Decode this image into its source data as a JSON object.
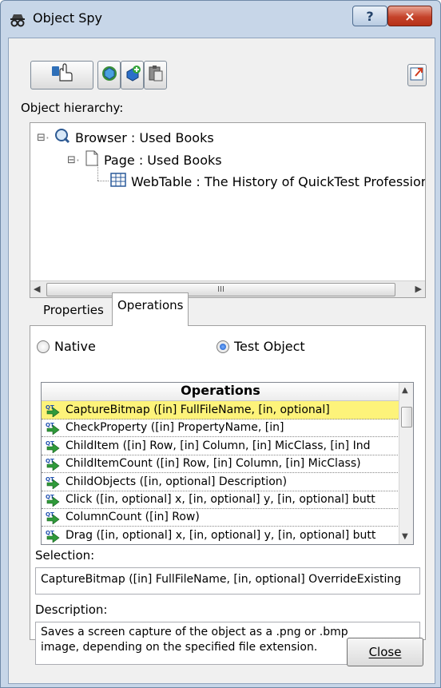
{
  "window": {
    "title": "Object Spy"
  },
  "titlebar": {
    "help_label": "?",
    "close_label": "×"
  },
  "toolbar": {
    "buttons": [
      {
        "icon": "pointing-hand-icon"
      },
      {
        "icon": "highlight-object-icon"
      },
      {
        "icon": "add-object-icon"
      },
      {
        "icon": "copy-clipboard-icon"
      },
      {
        "icon": "keep-on-top-icon"
      }
    ]
  },
  "hierarchy": {
    "label": "Object hierarchy:",
    "nodes": [
      {
        "text": "Browser : Used Books",
        "icon": "browser-icon",
        "expander": "⊟"
      },
      {
        "text": "Page : Used Books",
        "icon": "page-icon",
        "expander": "⊟"
      },
      {
        "text": "WebTable : The History of QuickTest Professior",
        "icon": "table-icon"
      }
    ],
    "scroll_thumb_label": "III"
  },
  "tabs": [
    {
      "label": "Properties",
      "active": false
    },
    {
      "label": "Operations",
      "active": true
    }
  ],
  "mode": {
    "native_label": "Native",
    "test_object_label": "Test Object",
    "selected": "Test Object"
  },
  "operations": {
    "header": "Operations",
    "items": [
      "CaptureBitmap ([in] FullFileName, [in, optional]",
      "CheckProperty ([in] PropertyName, [in]",
      "ChildItem ([in] Row, [in] Column, [in] MicClass, [in] Ind",
      "ChildItemCount ([in] Row, [in] Column, [in] MicClass)",
      "ChildObjects ([in, optional] Description)",
      "Click ([in, optional] x, [in, optional] y, [in, optional] butt",
      "ColumnCount ([in] Row)",
      "Drag ([in, optional] x, [in, optional] y, [in, optional] butt"
    ],
    "selected_index": 0
  },
  "selection": {
    "label": "Selection:",
    "value": "CaptureBitmap ([in] FullFileName, [in, optional] OverrideExisting"
  },
  "description": {
    "label": "Description:",
    "line1": "Saves a screen capture of the object as a .png or .bmp",
    "line2": "image, depending on the specified file extension."
  },
  "footer": {
    "close_label": "Close"
  }
}
